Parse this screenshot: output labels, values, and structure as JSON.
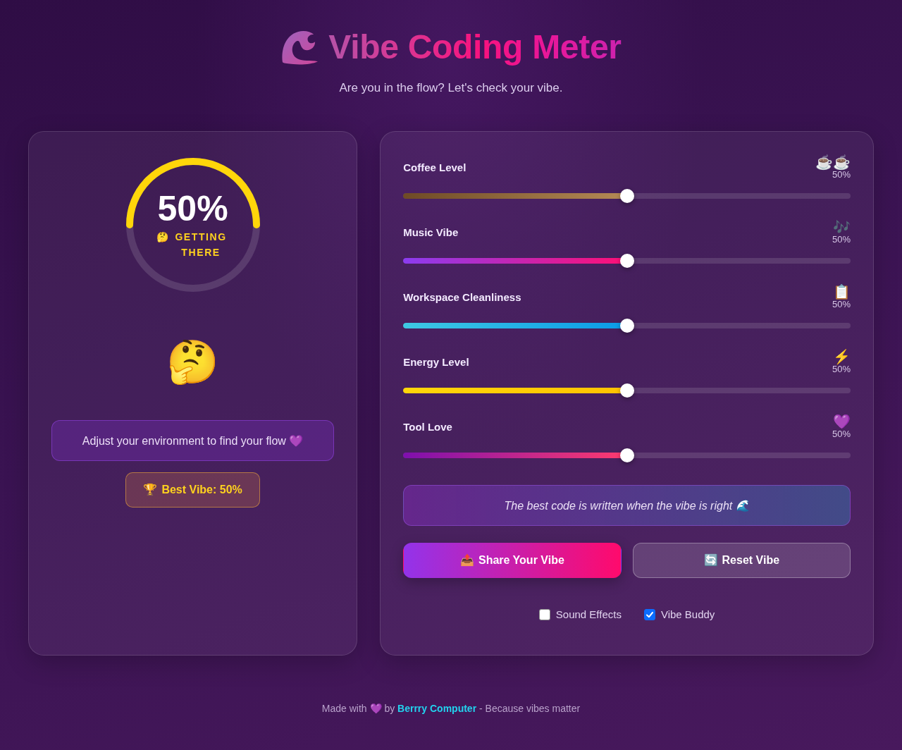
{
  "header": {
    "title": "Vibe Coding Meter",
    "subtitle": "Are you in the flow? Let's check your vibe."
  },
  "meter": {
    "level": 0.5,
    "reading": "50%",
    "status_icon": "🤔",
    "status": "GETTING THERE",
    "emoji": "🤔",
    "message": "Adjust your environment to find your flow 💜",
    "best": {
      "icon": "🏆",
      "label": "Best Vibe: 50%"
    }
  },
  "sliders": [
    {
      "kind": "coffee",
      "label": "Coffee Level",
      "icon": "☕️☕️",
      "reading": "50%",
      "level": 0.5
    },
    {
      "kind": "music",
      "label": "Music Vibe",
      "icon": "🎶",
      "reading": "50%",
      "level": 0.5
    },
    {
      "kind": "workspace",
      "label": "Workspace Cleanliness",
      "icon": "📋",
      "reading": "50%",
      "level": 0.5
    },
    {
      "kind": "energy",
      "label": "Energy Level",
      "icon": "⚡️",
      "reading": "50%",
      "level": 0.5
    },
    {
      "kind": "love",
      "label": "Tool Love",
      "icon": "💜",
      "reading": "50%",
      "level": 0.5
    }
  ],
  "quote": "The best code is written when the vibe is right 🌊",
  "buttons": [
    {
      "kind": "primary",
      "icon": "📤",
      "label": "Share Your Vibe"
    },
    {
      "kind": "secondary",
      "icon": "🔄",
      "label": "Reset Vibe"
    }
  ],
  "options": [
    {
      "label": "Sound Effects",
      "checked": false
    },
    {
      "label": "Vibe Buddy",
      "checked": true
    }
  ],
  "footer": {
    "before": "Made with 💜 by",
    "link": "Berrry Computer",
    "after": "- Because vibes matter"
  }
}
